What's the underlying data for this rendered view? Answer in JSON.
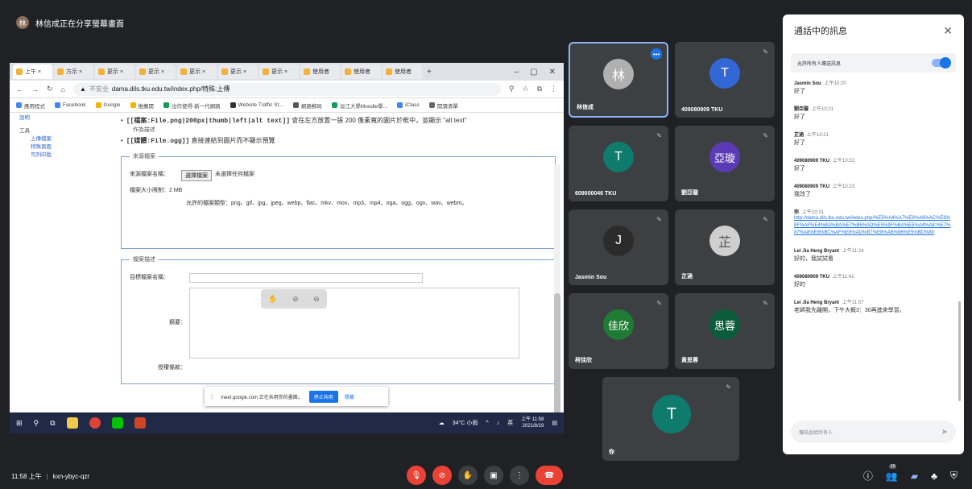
{
  "presenter": {
    "initial": "林",
    "label": "林信成正在分享螢幕畫面"
  },
  "browser": {
    "tabs": [
      "上午 ×",
      "方示 ×",
      "更示 ×",
      "更示 ×",
      "更示 ×",
      "更示 ×",
      "更示 ×",
      "使用者",
      "使用者",
      "使用者"
    ],
    "address": "dama.dils.tku.edu.tw/index.php/特殊:上傳",
    "security": "不安全",
    "bookmarks": [
      "應用程式",
      "Facebook",
      "Google",
      "推薦閱",
      "出作使得-新一代網路",
      "Website Traffic St...",
      "網路郵局",
      "淡江大學Moodle學...",
      "iClass",
      "閱讀清單"
    ]
  },
  "wiki": {
    "sidebar": {
      "top": "說明",
      "tools": "工具",
      "links": [
        "上傳檔案",
        "特殊頁面",
        "可列印版"
      ]
    },
    "bullet1_code": "[[檔案:File.png|200px|thumb|left|alt text]]",
    "bullet1_text": "會在左方放置一張 200 像素寬的圖片於框中，並顯示 \"alt text\"",
    "bullet1_sub": "作為描述",
    "bullet2_code": "[[媒體:File.ogg]]",
    "bullet2_text": "直接連結到圖片而不顯示預覽",
    "source_legend": "來源檔案",
    "source_label": "來源檔案名稱：",
    "choose_btn": "選擇檔案",
    "no_file": "未選擇任何檔案",
    "max_size": "檔案大小限制：2 MB",
    "allowed": "允許的檔案類型：png、gif、jpg、jpeg、webp、flac、mkv、mov、mp3、mp4、oga、ogg、ogv、wav、webm。",
    "desc_legend": "檔案描述",
    "dest_label": "目標檔案名稱：",
    "summary_label": "摘要：",
    "license_label": "授權條款："
  },
  "share_bar": {
    "text": "meet.google.com 正在共用你的畫面。",
    "stop": "停止共用",
    "hide": "隱藏"
  },
  "taskbar": {
    "weather": "34°C 小雨",
    "lang": "英",
    "time": "上午 11:58",
    "date": "2021/8/19"
  },
  "tiles": [
    {
      "name": "林信成",
      "initial": "林",
      "color": "#b0b0b0"
    },
    {
      "name": "409080909 TKU",
      "initial": "T",
      "color": "#3367d6"
    },
    {
      "name": "609000046 TKU",
      "initial": "T",
      "color": "#0f7b6c"
    },
    {
      "name": "劉亞璇",
      "initial": "亞璇",
      "color": "#5b3bb5"
    },
    {
      "name": "Jasmin Sou",
      "initial": "J",
      "color": "#2b2b2b"
    },
    {
      "name": "芷涵",
      "initial": "芷",
      "color": "#cfcfcf"
    },
    {
      "name": "柯佳欣",
      "initial": "佳欣",
      "color": "#1e7b34"
    },
    {
      "name": "黃思蓉",
      "initial": "思蓉",
      "color": "#0b5c3a"
    }
  ],
  "self": {
    "name": "你",
    "initial": "T"
  },
  "chat": {
    "title": "通話中的訊息",
    "allow": "允許所有人傳送訊息",
    "messages": [
      {
        "who": "Jasmin Sou",
        "time": "上午10:20",
        "text": "好了"
      },
      {
        "who": "劉亞璇",
        "time": "上午10:21",
        "text": "好了"
      },
      {
        "who": "芷涵",
        "time": "上午10:21",
        "text": "好了"
      },
      {
        "who": "409080909 TKU",
        "time": "上午10:22",
        "text": "好了"
      },
      {
        "who": "409080909 TKU",
        "time": "上午10:23",
        "text": "我改了"
      },
      {
        "who": "你",
        "time": "上午10:31",
        "link": "http://dama.dils.tku.edu.tw/index.php/%E5%A4%A7%E9%A6%AC%E8%8F%AF%E4%BA%BA%E7%B6%AD%E5%9F%BA%E5%A4%A8:%E7%87%A8%E8%BC%AF%E8%AD%B7%E8%AB%96%E5%BD%80"
      },
      {
        "who": "Lei Jia Heng Bryant",
        "time": "上午11:24",
        "text": "好的，我試試看"
      },
      {
        "who": "409080909 TKU",
        "time": "上午11:41",
        "text": "好的"
      },
      {
        "who": "Lei Jia Heng Bryant",
        "time": "上午11:57",
        "text": "老師我先離開，下午大概3：30再進來學習。"
      }
    ],
    "input_placeholder": "傳訊息給所有人"
  },
  "bottom": {
    "time": "11:58 上午",
    "separator": "|",
    "code": "kxn-ybyc-qzr",
    "people_count": "10"
  }
}
